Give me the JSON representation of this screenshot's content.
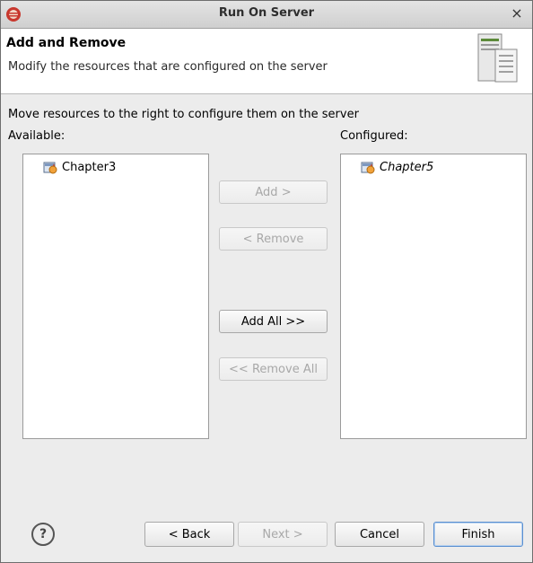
{
  "window": {
    "title": "Run On Server",
    "close_symbol": "×"
  },
  "header": {
    "title": "Add and Remove",
    "description": "Modify the resources that are configured on the server",
    "icon": "server-icon"
  },
  "instructions": "Move resources to the right to configure them on the server",
  "available": {
    "label": "Available:",
    "items": [
      "Chapter3"
    ]
  },
  "configured": {
    "label": "Configured:",
    "items": [
      "Chapter5"
    ]
  },
  "buttons": {
    "add": "Add >",
    "remove": "< Remove",
    "add_all": "Add All >>",
    "remove_all": "<< Remove All"
  },
  "footer": {
    "help_symbol": "?",
    "back": "< Back",
    "next": "Next >",
    "cancel": "Cancel",
    "finish": "Finish"
  }
}
